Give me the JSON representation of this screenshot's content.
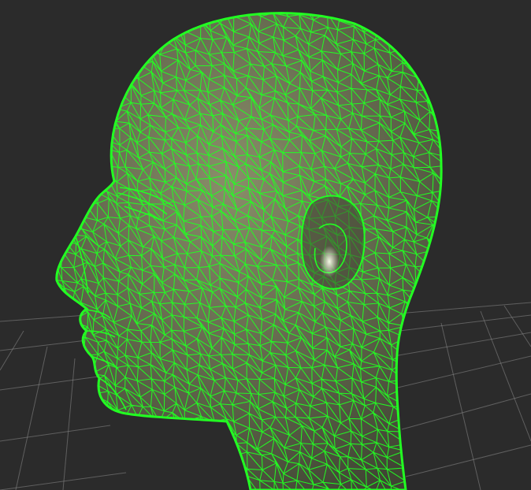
{
  "viewport": {
    "background_color": "#2b2b2b",
    "grid_color": "#8a8a8a",
    "mesh": {
      "wire_color": "#22ff22",
      "surface_color": "#8a8e6a",
      "surface_shadow_color": "#3f4433",
      "highlight_color": "#f4f8e4",
      "display_mode": "wireframe-over-shaded"
    }
  }
}
